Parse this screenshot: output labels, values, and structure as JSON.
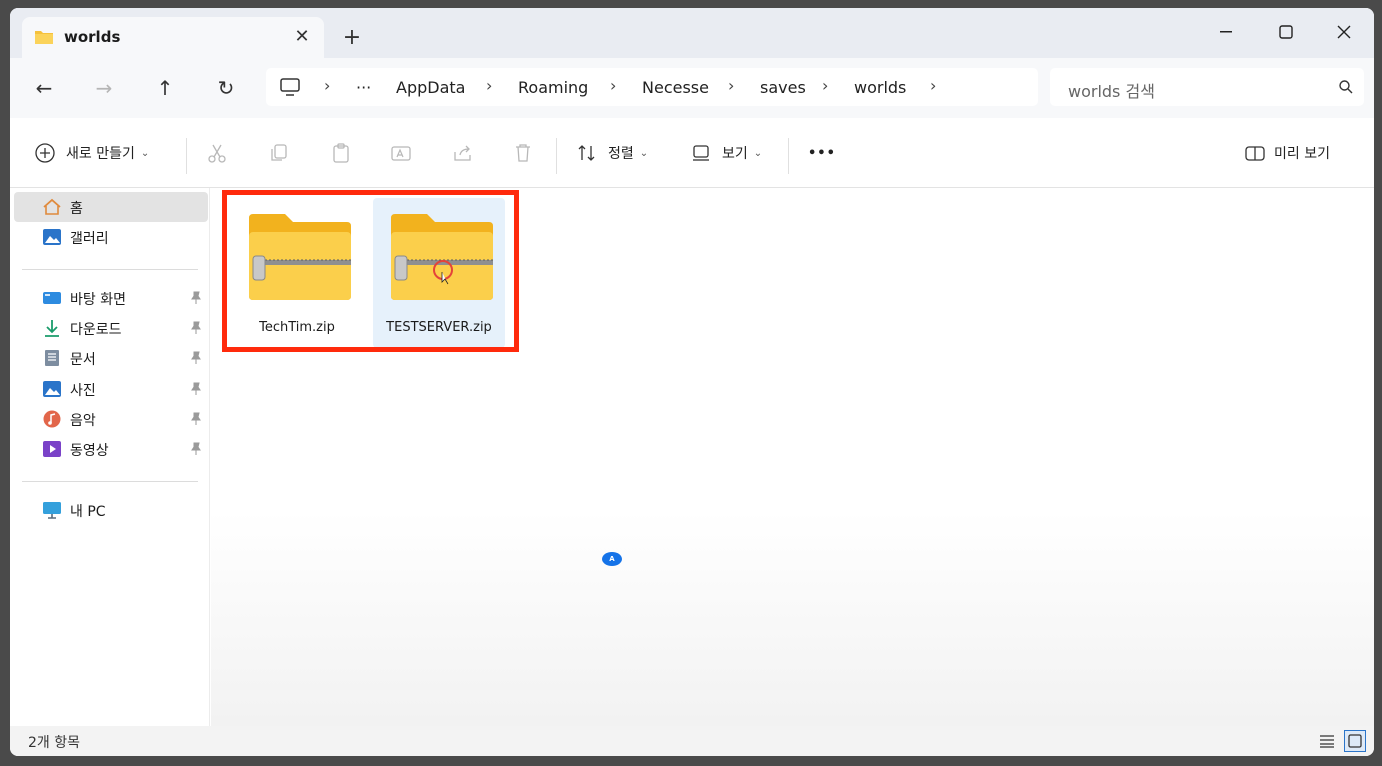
{
  "window": {
    "tab_title": "worlds",
    "tab_close": "✕",
    "new_tab": "+"
  },
  "navigation": {
    "back": "←",
    "forward": "→",
    "up": "↑",
    "refresh": "↻"
  },
  "address_bar": {
    "overflow": "···",
    "crumbs": [
      "AppData",
      "Roaming",
      "Necesse",
      "saves",
      "worlds"
    ]
  },
  "search": {
    "placeholder": "worlds 검색"
  },
  "toolbar": {
    "new_label": "새로 만들기",
    "sort_label": "정렬",
    "view_label": "보기",
    "more_label": "•••",
    "preview_label": "미리 보기"
  },
  "sidebar": {
    "home": "홈",
    "gallery": "갤러리",
    "pinned": [
      "바탕 화면",
      "다운로드",
      "문서",
      "사진",
      "음악",
      "동영상"
    ],
    "this_pc": "내 PC"
  },
  "files": [
    {
      "name": "TechTim.zip",
      "selected": false
    },
    {
      "name": "TESTSERVER.zip",
      "selected": true
    }
  ],
  "overlay_badge": "A",
  "status": {
    "item_count": "2개 항목"
  },
  "colors": {
    "highlight_box": "#ff2a0c",
    "accent": "#0067c0"
  }
}
